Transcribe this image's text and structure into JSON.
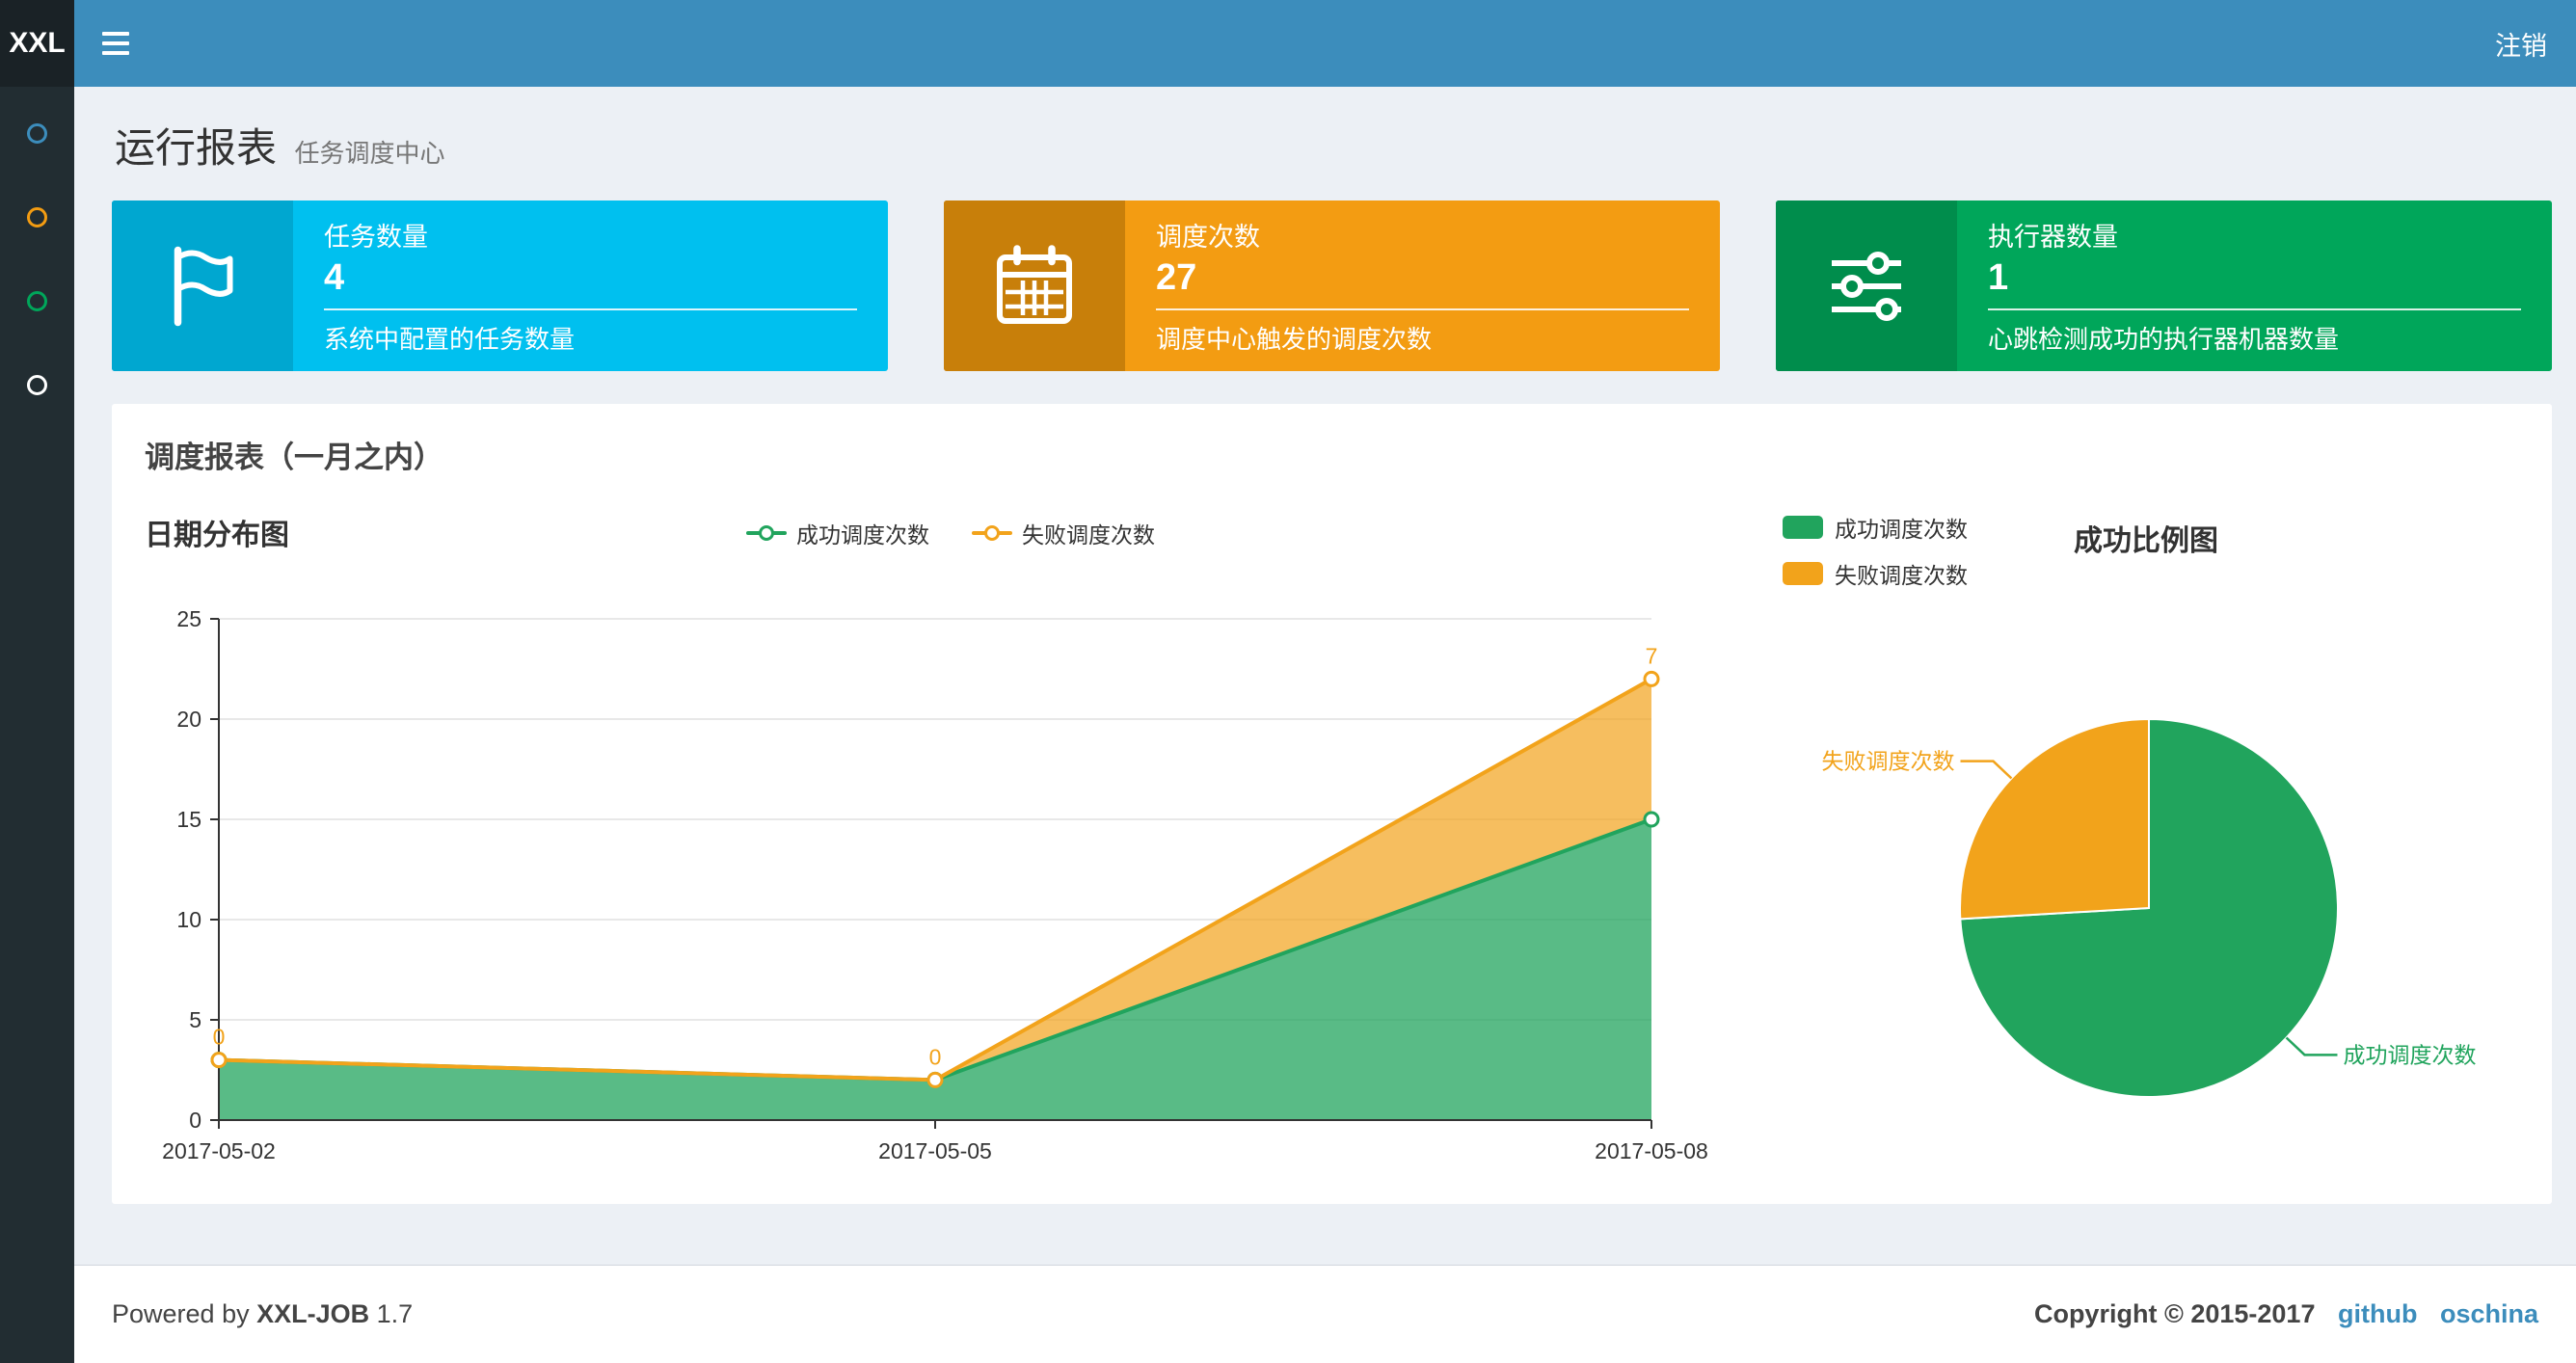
{
  "navbar": {
    "logo": "XXL",
    "logout": "注销"
  },
  "sidebar": {
    "items": [
      {
        "name": "item-1",
        "icon": "circle-icon",
        "color": "#3c8dbc"
      },
      {
        "name": "item-2",
        "icon": "circle-icon",
        "color": "#f39c12"
      },
      {
        "name": "item-3",
        "icon": "circle-icon",
        "color": "#00a65a"
      },
      {
        "name": "item-4",
        "icon": "circle-icon",
        "color": "#ffffff"
      }
    ]
  },
  "page": {
    "title": "运行报表",
    "subtitle": "任务调度中心"
  },
  "info_boxes": [
    {
      "icon": "flag-icon",
      "label": "任务数量",
      "value": "4",
      "desc": "系统中配置的任务数量",
      "color": "#00c0ef",
      "icon_color": "#00a7d0"
    },
    {
      "icon": "calendar-icon",
      "label": "调度次数",
      "value": "27",
      "desc": "调度中心触发的调度次数",
      "color": "#f39c12",
      "icon_color": "#c87f0a"
    },
    {
      "icon": "sliders-icon",
      "label": "执行器数量",
      "value": "1",
      "desc": "心跳检测成功的执行器机器数量",
      "color": "#00a65a",
      "icon_color": "#008d4c"
    }
  ],
  "panel": {
    "heading": "调度报表（一月之内）"
  },
  "chart_data": [
    {
      "type": "area",
      "title": "日期分布图",
      "x": [
        "2017-05-02",
        "2017-05-05",
        "2017-05-08"
      ],
      "series": [
        {
          "name": "成功调度次数",
          "values": [
            3,
            2,
            15
          ],
          "color": "#21a45d"
        },
        {
          "name": "失败调度次数",
          "values": [
            0,
            0,
            7
          ],
          "color": "#f2a31b",
          "point_labels": [
            "0",
            "0",
            "7"
          ]
        }
      ],
      "stacked": true,
      "ylim": [
        0,
        25
      ],
      "yticks": [
        0,
        5,
        10,
        15,
        20,
        25
      ],
      "grid": true,
      "legend_position": "top"
    },
    {
      "type": "pie",
      "title": "成功比例图",
      "slices": [
        {
          "name": "成功调度次数",
          "value": 20,
          "color": "#21a45d"
        },
        {
          "name": "失败调度次数",
          "value": 7,
          "color": "#f2a31b"
        }
      ],
      "legend_position": "left"
    }
  ],
  "footer": {
    "powered_by": "Powered by",
    "product": "XXL-JOB",
    "version": "1.7",
    "copyright": "Copyright © 2015-2017",
    "links": [
      "github",
      "oschina"
    ]
  }
}
